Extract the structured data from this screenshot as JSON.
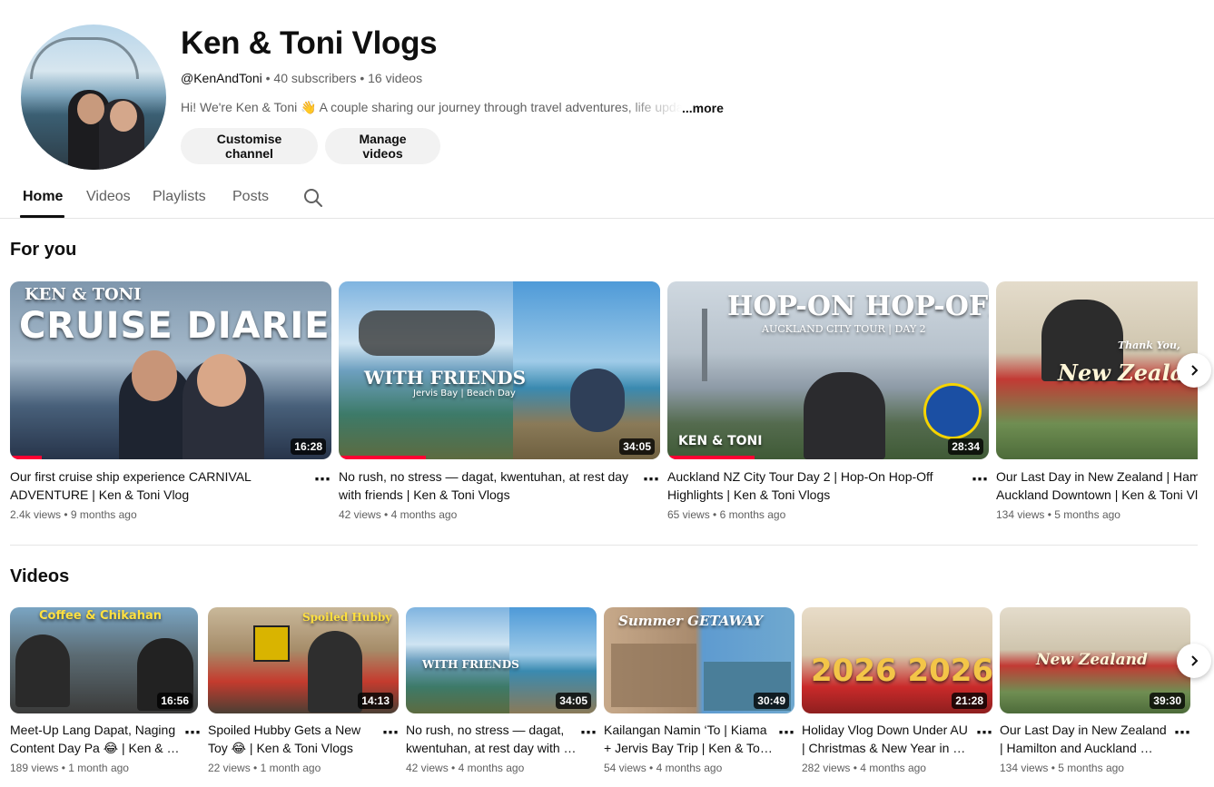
{
  "channel": {
    "title": "Ken & Toni Vlogs",
    "handle": "@KenAndToni",
    "subscribers": "40 subscribers",
    "videos_count": "16 videos",
    "description": "Hi! We're Ken & Toni 👋 A couple sharing our journey through travel adventures, life updat",
    "more_label": "...more",
    "customise_label": "Customise channel",
    "manage_label": "Manage videos"
  },
  "tabs": [
    {
      "label": "Home",
      "active": true
    },
    {
      "label": "Videos",
      "active": false
    },
    {
      "label": "Playlists",
      "active": false
    },
    {
      "label": "Posts",
      "active": false
    }
  ],
  "for_you": {
    "heading": "For you",
    "items": [
      {
        "title": "Our first cruise ship experience CARNIVAL ADVENTURE | Ken & Toni Vlog",
        "views": "2.4k views",
        "age": "9 months ago",
        "duration": "16:28",
        "caption": "CRUISE DIARIES",
        "subcaption": "KEN & TONI",
        "progress": 0.1
      },
      {
        "title": "No rush, no stress — dagat, kwentuhan, at rest day with friends | Ken & Toni Vlogs",
        "views": "42 views",
        "age": "4 months ago",
        "duration": "34:05",
        "caption": "WITH FRIENDS",
        "subcaption": "Jervis Bay | Beach Day",
        "progress": 0.27
      },
      {
        "title": "Auckland NZ City Tour Day 2 | Hop-On Hop-Off Highlights | Ken & Toni Vlogs",
        "views": "65 views",
        "age": "6 months ago",
        "duration": "28:34",
        "caption": "HOP-ON HOP-OFF",
        "subcaption": "AUCKLAND CITY TOUR | DAY 2",
        "progress": 0.27
      },
      {
        "title": "Our Last Day in New Zealand | Hamilton and Auckland Downtown | Ken & Toni Vlogs",
        "views": "134 views",
        "age": "5 months ago",
        "duration": "",
        "caption": "New Zealand",
        "subcaption": "Thank You,",
        "progress": 0
      }
    ]
  },
  "videos": {
    "heading": "Videos",
    "items": [
      {
        "title": "Meet-Up Lang Dapat, Naging Content Day Pa 😂 | Ken & …",
        "views": "189 views",
        "age": "1 month ago",
        "duration": "16:56",
        "caption": "Coffee & Chikahan"
      },
      {
        "title": "Spoiled Hubby Gets a New Toy 😂 | Ken & Toni Vlogs",
        "views": "22 views",
        "age": "1 month ago",
        "duration": "14:13",
        "caption": "Spoiled Hubby"
      },
      {
        "title": "No rush, no stress — dagat, kwentuhan, at rest day with …",
        "views": "42 views",
        "age": "4 months ago",
        "duration": "34:05",
        "caption": "WITH FRIENDS"
      },
      {
        "title": "Kailangan Namin ‘To | Kiama + Jervis Bay Trip | Ken & To…",
        "views": "54 views",
        "age": "4 months ago",
        "duration": "30:49",
        "caption": "Summer GETAWAY"
      },
      {
        "title": "Holiday Vlog Down Under AU | Christmas & New Year in …",
        "views": "282 views",
        "age": "4 months ago",
        "duration": "21:28",
        "caption": "2026 2026"
      },
      {
        "title": "Our Last Day in New Zealand | Hamilton and Auckland …",
        "views": "134 views",
        "age": "5 months ago",
        "duration": "39:30",
        "caption": "New Zealand"
      }
    ]
  },
  "icons": {
    "search": "search-icon",
    "next": "chevron-right-icon",
    "more": "more-vert-icon"
  },
  "colors": {
    "progress": "#ff0033",
    "pill_bg": "#f2f2f2",
    "meta_text": "#606060"
  }
}
